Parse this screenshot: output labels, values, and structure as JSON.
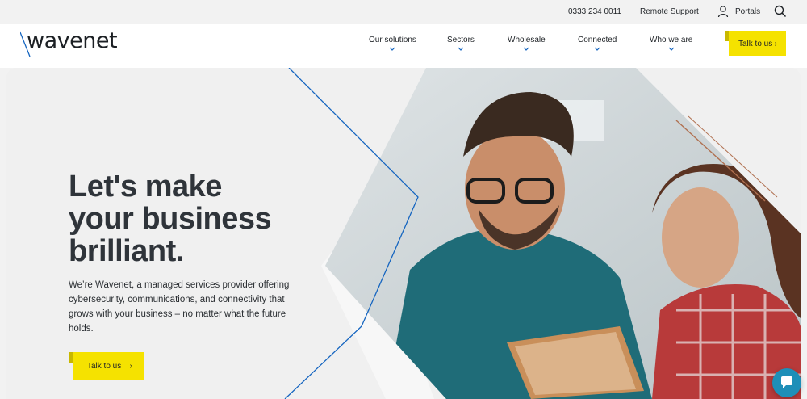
{
  "topbar": {
    "phone": "0333 234 0011",
    "remote_support": "Remote Support",
    "portals": "Portals",
    "portals_icon": "user-icon",
    "search_icon": "search-icon"
  },
  "brand": {
    "name": "wavenet"
  },
  "nav": {
    "items": [
      {
        "label": "Our solutions"
      },
      {
        "label": "Sectors"
      },
      {
        "label": "Wholesale"
      },
      {
        "label": "Connected"
      },
      {
        "label": "Who we are"
      }
    ],
    "cta": "Talk to us"
  },
  "hero": {
    "headline_line1": "Let's make",
    "headline_line2": "your business",
    "headline_line3": "brilliant.",
    "description": "We’re Wavenet, a managed services provider offering cybersecurity, communications, and connectivity that grows with your business – no matter what the future holds.",
    "cta": "Talk to us"
  },
  "chat": {
    "icon": "chat-icon"
  },
  "colors": {
    "accent_yellow": "#f5e200",
    "accent_blue": "#1565c0",
    "chat_blue": "#1e8fb8",
    "text_dark": "#2f343a",
    "background": "#f2f2f2"
  }
}
